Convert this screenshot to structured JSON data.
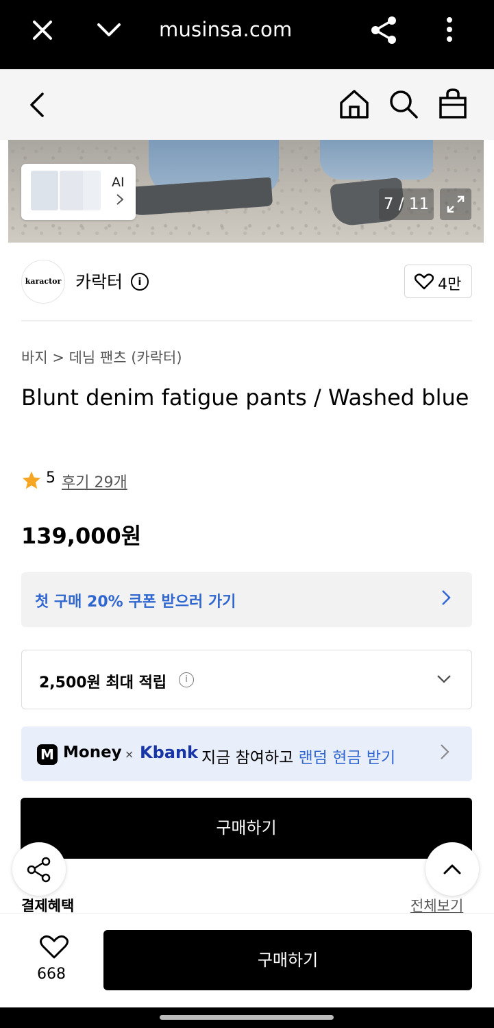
{
  "browser": {
    "url": "musinsa.com"
  },
  "hero": {
    "ai_label": "AI",
    "counter": "7 / 11"
  },
  "brand": {
    "logo_text": "karactor",
    "name": "카락터",
    "likes": "4만"
  },
  "breadcrumb": "바지 > 데님 팬츠 (카락터)",
  "product": {
    "title": "Blunt denim fatigue pants / Washed blue",
    "rating": "5",
    "reviews": "후기 29개",
    "price": "139,000원"
  },
  "coupon": {
    "label": "첫 구매 20% 쿠폰 받으러 가기"
  },
  "points": {
    "label": "2,500원 최대 적립"
  },
  "money_banner": {
    "logo": "M",
    "money": "Money",
    "times": "×",
    "kbank": "Kbank",
    "text": "지금 참여하고 ",
    "highlight": "랜덤 현금 받기"
  },
  "buy_label": "구매하기",
  "benefit_section": {
    "title": "결제혜택",
    "view_all": "전체보기"
  },
  "bottom_bar": {
    "wish_count": "668",
    "buy_label": "구매하기"
  }
}
